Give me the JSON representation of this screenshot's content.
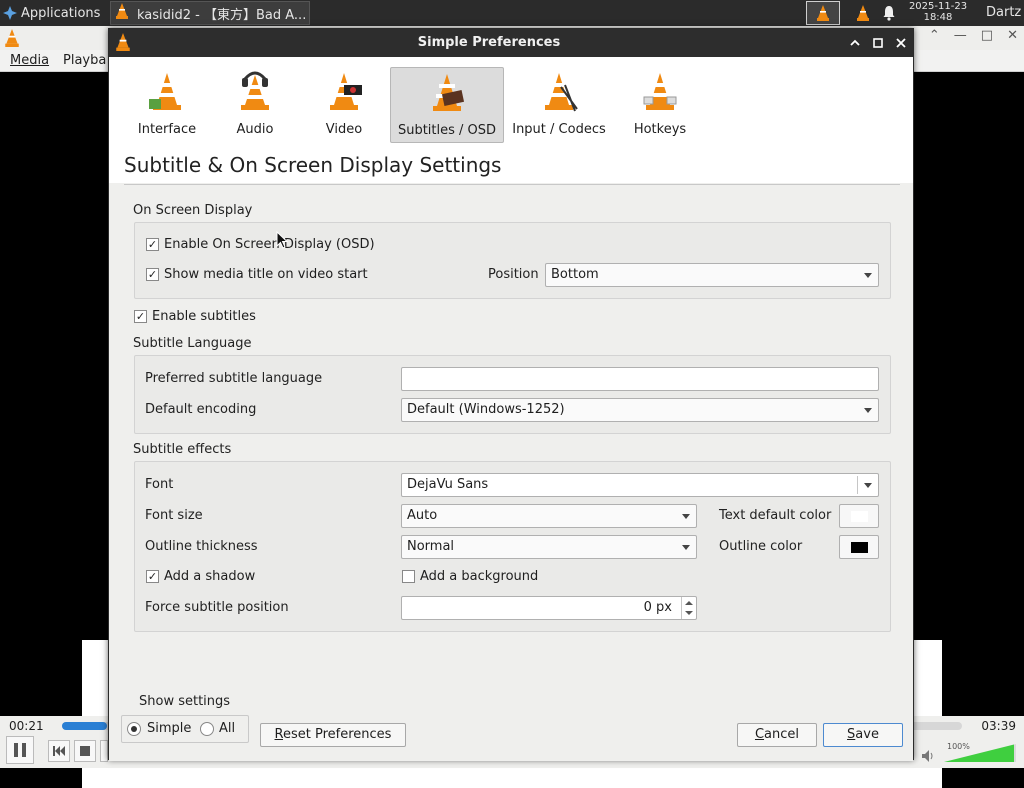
{
  "taskbar": {
    "applications_label": "Applications",
    "task_title": "kasidid2 - 【東方】Bad A...",
    "clock_date": "2025-11-23",
    "clock_time": "18:48",
    "user": "Dartz"
  },
  "background_player": {
    "menu": [
      "Media",
      "Playba"
    ],
    "time_elapsed": "00:21",
    "time_total": "03:39",
    "volume_label": "100%",
    "seek_progress": 0.05
  },
  "dialog": {
    "title": "Simple Preferences",
    "categories": [
      {
        "label": "Interface",
        "icon": "interface-cone-icon"
      },
      {
        "label": "Audio",
        "icon": "audio-cone-icon"
      },
      {
        "label": "Video",
        "icon": "video-cone-icon"
      },
      {
        "label": "Subtitles / OSD",
        "icon": "subtitles-cone-icon",
        "active": true
      },
      {
        "label": "Input / Codecs",
        "icon": "input-cone-icon"
      },
      {
        "label": "Hotkeys",
        "icon": "hotkeys-cone-icon"
      }
    ],
    "heading": "Subtitle & On Screen Display Settings",
    "osd": {
      "section_label": "On Screen Display",
      "enable_osd": "Enable On Screen Display (OSD)",
      "show_title": "Show media title on video start",
      "position_label": "Position",
      "position_value": "Bottom"
    },
    "enable_subtitles": "Enable subtitles",
    "language": {
      "section_label": "Subtitle Language",
      "preferred_label": "Preferred subtitle language",
      "preferred_value": "",
      "encoding_label": "Default encoding",
      "encoding_value": "Default (Windows-1252)"
    },
    "effects": {
      "section_label": "Subtitle effects",
      "font_label": "Font",
      "font_value": "DejaVu Sans",
      "font_size_label": "Font size",
      "font_size_value": "Auto",
      "text_color_label": "Text default color",
      "text_color": "#ffffff",
      "outline_label": "Outline thickness",
      "outline_value": "Normal",
      "outline_color_label": "Outline color",
      "outline_color": "#000000",
      "shadow_label": "Add a shadow",
      "background_label": "Add a background",
      "force_pos_label": "Force subtitle position",
      "force_pos_value": "0 px"
    },
    "show_settings": {
      "label": "Show settings",
      "simple": "Simple",
      "all": "All"
    },
    "buttons": {
      "reset": "Reset Preferences",
      "cancel": "Cancel",
      "save": "Save"
    }
  }
}
